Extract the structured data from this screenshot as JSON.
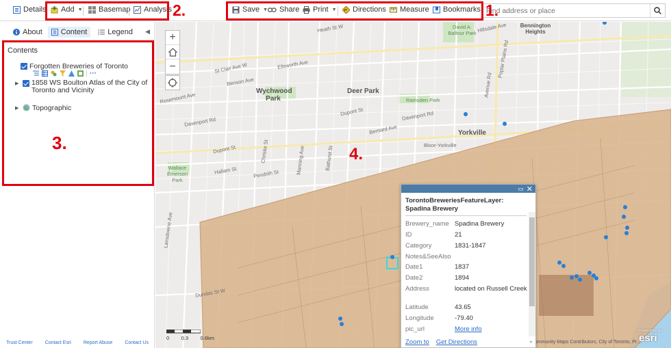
{
  "toolbar": {
    "details": "Details",
    "add": "Add",
    "basemap": "Basemap",
    "analysis": "Analysis",
    "save": "Save",
    "share": "Share",
    "print": "Print",
    "directions": "Directions",
    "measure": "Measure",
    "bookmarks": "Bookmarks"
  },
  "search": {
    "placeholder": "Find address or place"
  },
  "annotations": {
    "n1": "1.",
    "n2": "2.",
    "n3": "3.",
    "n4": "4."
  },
  "panel": {
    "tabs": {
      "about": "About",
      "content": "Content",
      "legend": "Legend"
    },
    "title": "Contents",
    "layers": {
      "breweries": "Forgotten Breweries of Toronto",
      "atlas_line1": "1858 WS Boulton Atlas of the City of",
      "atlas_line2": "Toronto and Vicinity",
      "topo": "Topographic"
    },
    "footer": {
      "trust": "Trust Center",
      "contact": "Contact Esri",
      "abuse": "Report Abuse",
      "us": "Contact Us"
    }
  },
  "map": {
    "labels": {
      "wychwood": "Wychwood Park",
      "deer_park": "Deer Park",
      "yorkville": "Yorkville",
      "bennington": "Bennington Heights",
      "wallace": "Wallace Emerson Park",
      "bloor_yorkville": "Bloor-Yorkville",
      "david_balfour": "David A. Balfour Park",
      "ramsden": "Ramsden Park",
      "st_clair": "St Clair Ave W",
      "davenport": "Davenport Rd",
      "dupont": "Dupont St",
      "bernard": "Bernard Ave",
      "dundas": "Dundas St W",
      "hallam": "Hallam St",
      "pendrith": "Pendrith St",
      "benson": "Benson Ave",
      "ellsworth": "Ellsworth Ave",
      "heath": "Heath St W",
      "rosemount": "Rosemount Ave",
      "christie": "Christie St",
      "bathurst": "Bathurst St",
      "lansdowne": "Lansdowne Ave",
      "hillsdale": "Hillsdale Ave",
      "avenue_rd": "Avenue Rd",
      "poplar": "Poplar Plains Rd",
      "manning": "Manning Ave"
    },
    "scale": {
      "s0": "0",
      "s1": "0.3",
      "s2": "0.6km"
    },
    "attribution": "ommunity Maps Contributors, City of Toronto, Pr...",
    "esri_powered": "POWERED BY",
    "esri_logo": "esri"
  },
  "popup": {
    "title": "TorontoBreweriesFeatureLayer: Spadina Brewery",
    "rows": [
      {
        "k": "Brewery_name",
        "v": "Spadina Brewery"
      },
      {
        "k": "ID",
        "v": "21"
      },
      {
        "k": "Category",
        "v": "1831-1847"
      },
      {
        "k": "Notes&SeeAlso",
        "v": ""
      },
      {
        "k": "Date1",
        "v": "1837"
      },
      {
        "k": "Date2",
        "v": "1894"
      },
      {
        "k": "Address",
        "v": "located on Russell Creek"
      },
      {
        "k": "Latitude",
        "v": "43.65"
      },
      {
        "k": "Longitude",
        "v": "-79.40"
      },
      {
        "k": "pic_url",
        "v": "More info"
      }
    ],
    "zoom_to": "Zoom to",
    "get_directions": "Get Directions"
  },
  "colors": {
    "accent": "#2a6bc5",
    "annotation": "#e0000e",
    "popup_header": "#4c7ba7"
  }
}
